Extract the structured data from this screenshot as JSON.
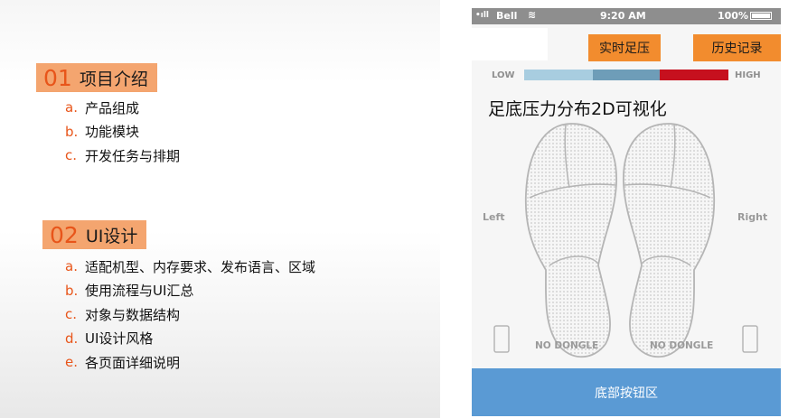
{
  "slide": {
    "sections": [
      {
        "num": "01",
        "title": "项目介绍",
        "items": [
          {
            "mark": "a.",
            "text": "产品组成"
          },
          {
            "mark": "b.",
            "text": "功能模块"
          },
          {
            "mark": "c.",
            "text": "开发任务与排期"
          }
        ]
      },
      {
        "num": "02",
        "title": "UI设计",
        "items": [
          {
            "mark": "a.",
            "text": "适配机型、内存要求、发布语言、区域"
          },
          {
            "mark": "b.",
            "text": "使用流程与UI汇总"
          },
          {
            "mark": "c.",
            "text": "对象与数据结构"
          },
          {
            "mark": "d.",
            "text": "UI设计风格"
          },
          {
            "mark": "e.",
            "text": "各页面详细说明"
          }
        ]
      }
    ]
  },
  "phone": {
    "status": {
      "carrier": "Bell",
      "time": "9:20 AM",
      "battery": "100%"
    },
    "header": {
      "realtime_button": "实时足压",
      "history_button": "历史记录"
    },
    "legend": {
      "low": "LOW",
      "high": "HIGH"
    },
    "title": "足底压力分布2D可视化",
    "labels": {
      "left": "Left",
      "right": "Right",
      "no_dongle_left": "NO DONGLE",
      "no_dongle_right": "NO DONGLE"
    },
    "bottom_bar": "底部按钮区"
  },
  "colors": {
    "accent_orange": "#f28c2e",
    "section_head_bg": "#f4a56f",
    "section_number": "#e8551a",
    "legend_low": "#a8cde0",
    "legend_mid": "#6e9db8",
    "legend_high": "#c6101e",
    "bottom_bar": "#5a9ad4"
  }
}
